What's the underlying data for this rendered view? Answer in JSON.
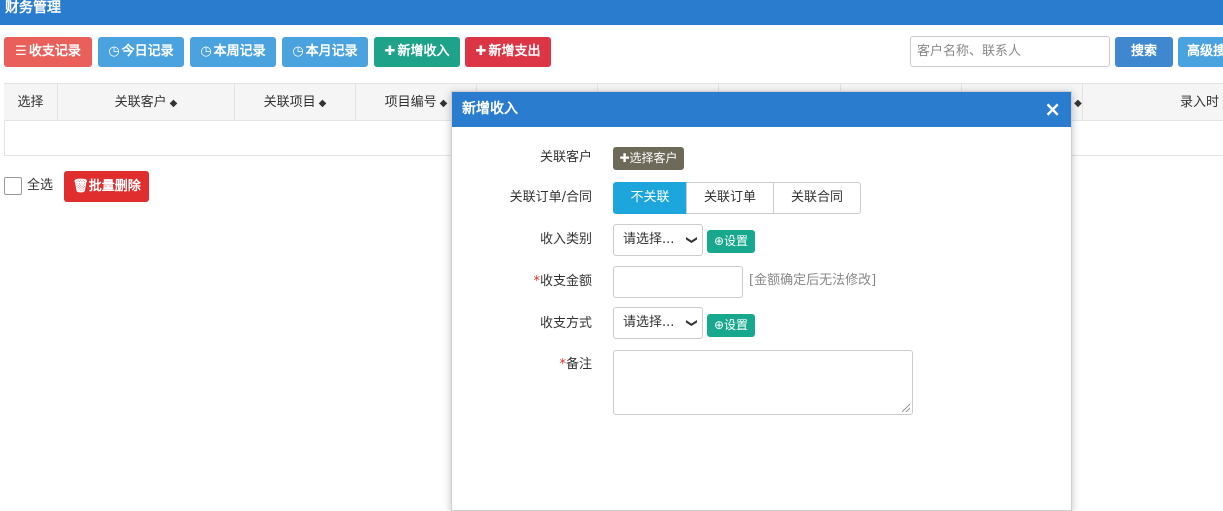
{
  "header": {
    "title": "财务管理"
  },
  "toolbar": {
    "records_label": "收支记录",
    "today_label": "今日记录",
    "week_label": "本周记录",
    "month_label": "本月记录",
    "add_income_label": "新增收入",
    "add_expense_label": "新增支出"
  },
  "search": {
    "placeholder": "客户名称、联系人",
    "search_label": "搜索",
    "advanced_label": "高级搜"
  },
  "table": {
    "columns": [
      "选择",
      "关联客户",
      "关联项目",
      "项目编号",
      "录入时"
    ]
  },
  "footer": {
    "select_all_label": "全选",
    "batch_delete_label": "批量删除"
  },
  "modal": {
    "title": "新增收入",
    "close_icon": "×",
    "customer_label": "关联客户",
    "choose_customer_label": "选择客户",
    "link_label": "关联订单/合同",
    "link_options": [
      "不关联",
      "关联订单",
      "关联合同"
    ],
    "link_selected": "不关联",
    "category_label": "收入类别",
    "category_value": "请选择...",
    "settings_label": "设置",
    "amount_label": "收支金额",
    "amount_note": "[金额确定后无法修改]",
    "method_label": "收支方式",
    "method_value": "请选择...",
    "remark_label": "备注",
    "required_mark": "*"
  },
  "colors": {
    "primary": "#2a7ccf",
    "danger": "#e02d2d",
    "success": "#1ea28a",
    "info": "#4aa3df",
    "accent": "#1da6dc"
  }
}
